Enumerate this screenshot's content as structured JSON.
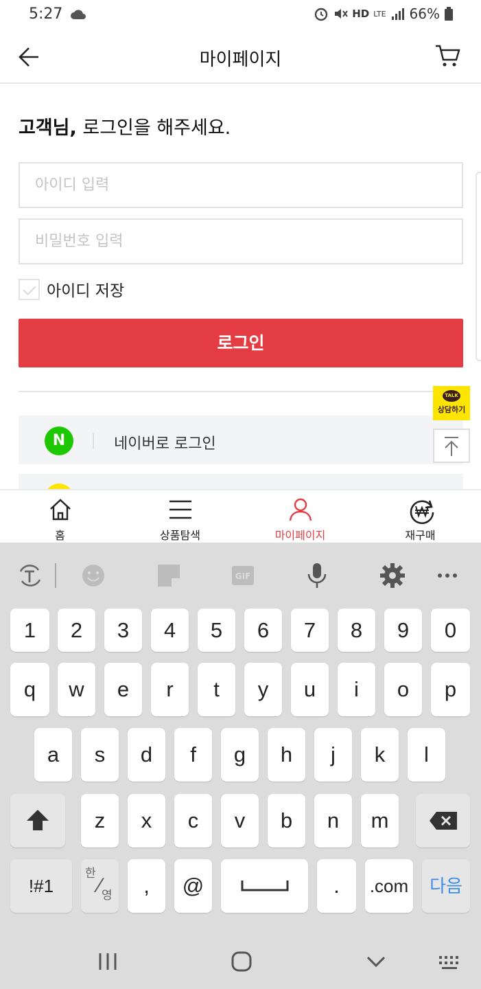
{
  "status_bar": {
    "time": "5:27",
    "network": "HD",
    "network_sub": "LTE",
    "battery": "66%"
  },
  "header": {
    "title": "마이페이지"
  },
  "login": {
    "greeting_bold": "고객님,",
    "greeting_rest": " 로그인을 해주세요.",
    "id_placeholder": "아이디 입력",
    "pw_placeholder": "비밀번호 입력",
    "save_id_label": "아이디 저장",
    "save_id_checked": false,
    "login_button": "로그인",
    "naver_icon_letter": "N",
    "naver_label": "네이버로 로그인"
  },
  "floating": {
    "talk_bubble": "TALK",
    "talk_label": "상담하기"
  },
  "bottom_nav": {
    "items": [
      {
        "label": "홈",
        "icon": "home-icon",
        "active": false
      },
      {
        "label": "상품탐색",
        "icon": "menu-icon",
        "active": false
      },
      {
        "label": "마이페이지",
        "icon": "user-icon",
        "active": true
      },
      {
        "label": "재구매",
        "icon": "won-reorder-icon",
        "active": false
      }
    ]
  },
  "keyboard": {
    "numbers": [
      "1",
      "2",
      "3",
      "4",
      "5",
      "6",
      "7",
      "8",
      "9",
      "0"
    ],
    "row1": [
      "q",
      "w",
      "e",
      "r",
      "t",
      "y",
      "u",
      "i",
      "o",
      "p"
    ],
    "row2": [
      "a",
      "s",
      "d",
      "f",
      "g",
      "h",
      "j",
      "k",
      "l"
    ],
    "row3": [
      "z",
      "x",
      "c",
      "v",
      "b",
      "n",
      "m"
    ],
    "symbols_key": "!#1",
    "lang_top": "한",
    "lang_bottom": "영",
    "comma": ",",
    "at": "@",
    "period": ".",
    "dotcom": ".com",
    "next_key": "다음",
    "accent_color": "#3d8ee6"
  },
  "colors": {
    "brand_red": "#e33d43",
    "naver_green": "#1ec800",
    "kakao_yellow": "#fee500"
  }
}
